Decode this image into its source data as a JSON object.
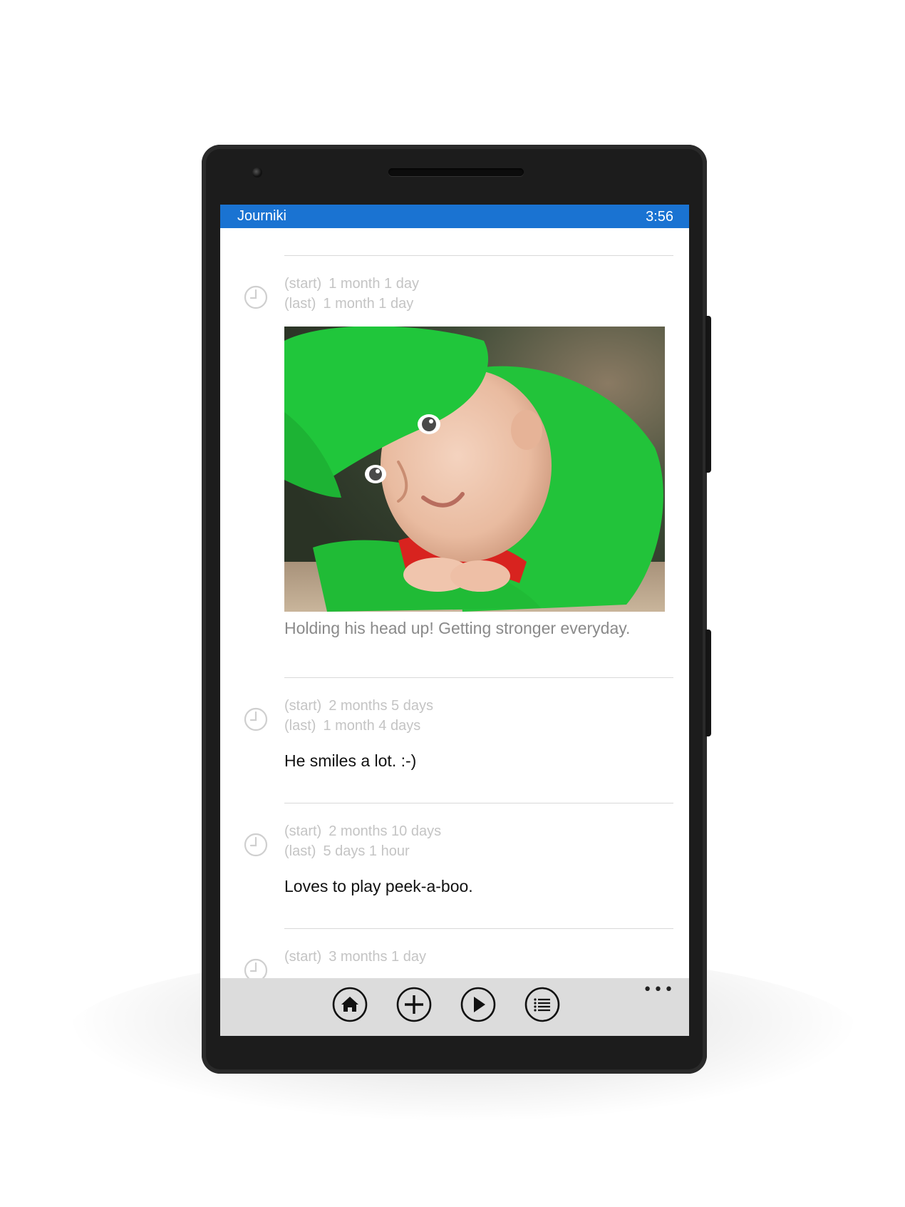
{
  "app": {
    "title": "Journiki",
    "time": "3:56"
  },
  "entries": [
    {
      "start_label": "(start)",
      "start_value": "1 month 1 day",
      "last_label": "(last)",
      "last_value": "1 month 1 day",
      "caption": "Holding his head up! Getting stronger everyday."
    },
    {
      "start_label": "(start)",
      "start_value": "2 months 5 days",
      "last_label": "(last)",
      "last_value": "1 month 4 days",
      "note": "He smiles a lot. :-)"
    },
    {
      "start_label": "(start)",
      "start_value": "2 months 10 days",
      "last_label": "(last)",
      "last_value": "5 days 1 hour",
      "note": "Loves to play peek-a-boo."
    },
    {
      "start_label": "(start)",
      "start_value": "3 months 1 day"
    }
  ],
  "appbar": {
    "buttons": [
      "home-icon",
      "add-icon",
      "play-icon",
      "list-icon"
    ],
    "more": "•••"
  },
  "colors": {
    "accent": "#1a73d2",
    "appbar": "#dcdcdc"
  }
}
